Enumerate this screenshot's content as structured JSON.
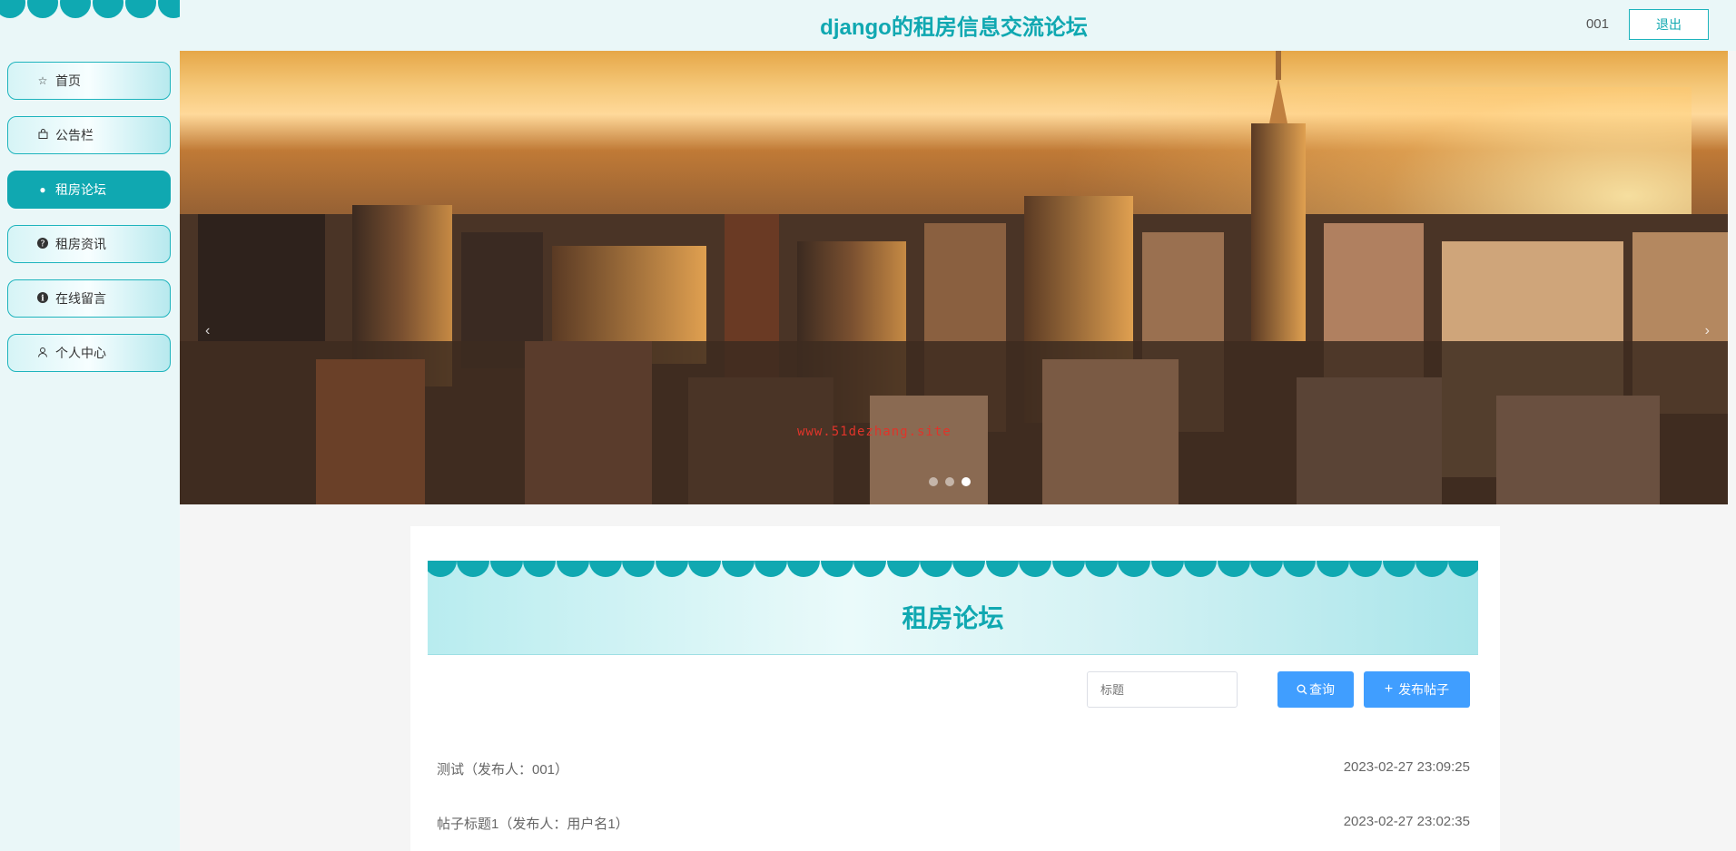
{
  "header": {
    "site_title": "django的租房信息交流论坛",
    "user_name": "001",
    "logout_label": "退出"
  },
  "sidebar": {
    "items": [
      {
        "label": "首页",
        "icon": "star-icon"
      },
      {
        "label": "公告栏",
        "icon": "bag-icon"
      },
      {
        "label": "租房论坛",
        "icon": "circle-icon",
        "active": true
      },
      {
        "label": "租房资讯",
        "icon": "question-icon"
      },
      {
        "label": "在线留言",
        "icon": "info-icon"
      },
      {
        "label": "个人中心",
        "icon": "user-icon"
      }
    ]
  },
  "banner": {
    "watermark": "www.51dezhang.site",
    "slide_count": 3,
    "active_slide": 3
  },
  "forum": {
    "title": "租房论坛",
    "search_placeholder": "标题",
    "search_label": "查询",
    "post_label": "发布帖子",
    "posts": [
      {
        "title": "测试（发布人：001）",
        "time": "2023-02-27 23:09:25"
      },
      {
        "title": "帖子标题1（发布人：用户名1）",
        "time": "2023-02-27 23:02:35"
      }
    ]
  },
  "colors": {
    "accent": "#10a8b1",
    "button_blue": "#409eff",
    "sidebar_bg": "#eaf7f8"
  }
}
